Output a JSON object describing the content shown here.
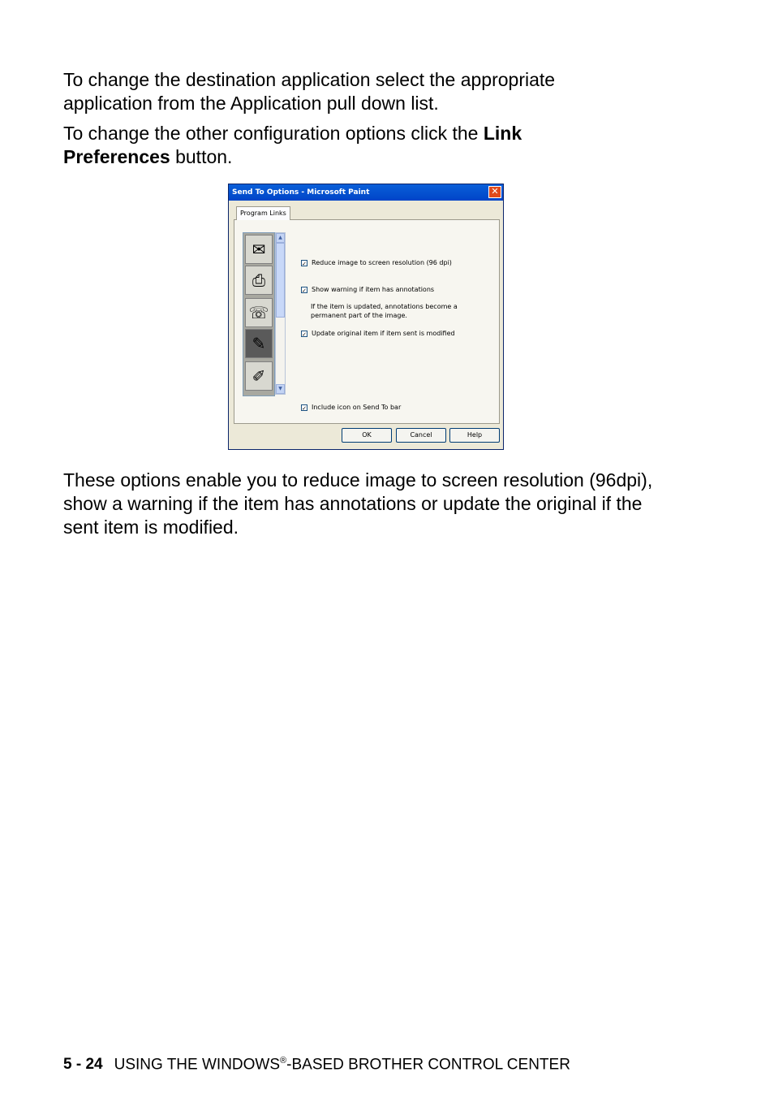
{
  "intro": {
    "p1": "To change the destination application select the appropriate application from the Application pull down list.",
    "p2_start": "To change the other configuration options click the ",
    "p2_bold": "Link Preferences",
    "p2_end": " button."
  },
  "dialog": {
    "title": "Send To Options - Microsoft Paint",
    "close_glyph": "✕",
    "tab_label": "Program Links",
    "options": [
      {
        "label": "Reduce image to screen resolution (96 dpi)",
        "checked": true
      },
      {
        "label": "Show warning if item has annotations",
        "checked": true
      },
      {
        "label": "Update original item if item sent is modified",
        "checked": true
      },
      {
        "label": "Include icon on Send To bar",
        "checked": true
      }
    ],
    "note": "If the item is updated, annotations become a permanent part of the image.",
    "buttons": {
      "ok": "OK",
      "cancel": "Cancel",
      "help": "Help"
    },
    "icons": [
      "mail-icon",
      "printer-icon",
      "fax-icon",
      "paint-icon",
      "notepad-icon"
    ],
    "check_glyph": "✓"
  },
  "outro": "These options enable you to reduce image to screen resolution (96dpi), show a warning if the item has annotations or update the original if the sent item is modified.",
  "footer": {
    "page": "5 - 24",
    "text_start": "USING THE WINDOWS",
    "registered": "®",
    "text_end": "-BASED BROTHER CONTROL CENTER"
  }
}
